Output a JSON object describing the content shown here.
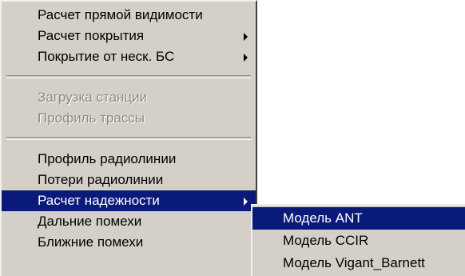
{
  "main_menu": {
    "items": [
      {
        "label": "Расчет прямой видимости"
      },
      {
        "label": "Расчет покрытия",
        "submenu": true
      },
      {
        "label": "Покрытие от неск. БС",
        "submenu": true
      },
      {
        "label": "Загрузка станции",
        "disabled": true
      },
      {
        "label": "Профиль трассы",
        "disabled": true
      },
      {
        "label": "Профиль радиолинии"
      },
      {
        "label": "Потери радиолинии"
      },
      {
        "label": "Расчет надежности",
        "submenu": true,
        "selected": true
      },
      {
        "label": "Дальние помехи"
      },
      {
        "label": "Ближние помехи"
      }
    ]
  },
  "sub_menu": {
    "items": [
      {
        "label": "Модель ANT",
        "selected": true
      },
      {
        "label": "Модель CCIR"
      },
      {
        "label": "Модель Vigant_Barnett"
      }
    ]
  },
  "colors": {
    "menu_bg": "#d4d0c8",
    "highlight": "#0a1a7a",
    "disabled_text": "#8c8a84"
  }
}
